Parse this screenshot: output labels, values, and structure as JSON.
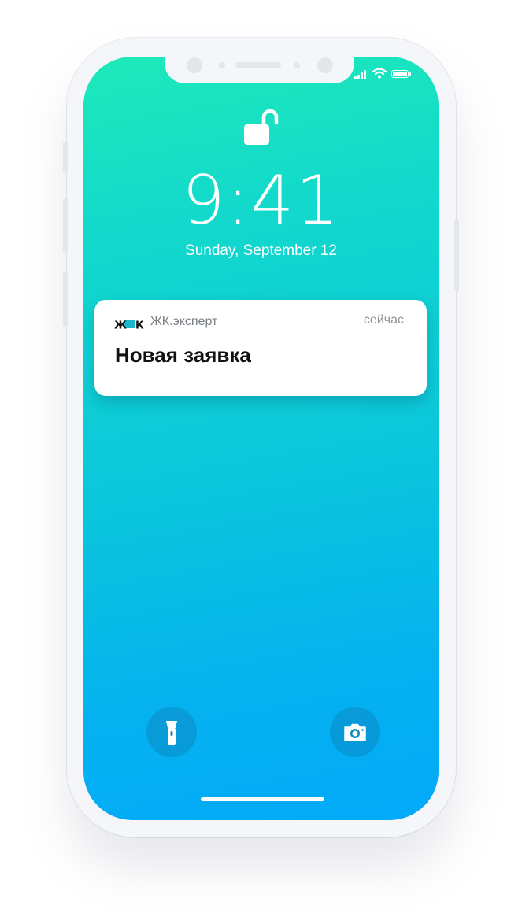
{
  "lock_screen": {
    "time": "9:41",
    "date": "Sunday, September 12"
  },
  "notification": {
    "app_logo_text": "ЖК",
    "app_name": "ЖК.эксперт",
    "time": "сейчас",
    "title": "Новая заявка"
  },
  "icons": {
    "status": [
      "signal-icon",
      "wifi-icon",
      "battery-icon"
    ],
    "lock": "unlocked-padlock-icon",
    "quick_actions": [
      "flashlight-icon",
      "camera-icon"
    ]
  },
  "colors": {
    "gradient_top": "#1ee9b9",
    "gradient_bottom": "#03a9f9",
    "logo_accent": "#19b7c9"
  }
}
